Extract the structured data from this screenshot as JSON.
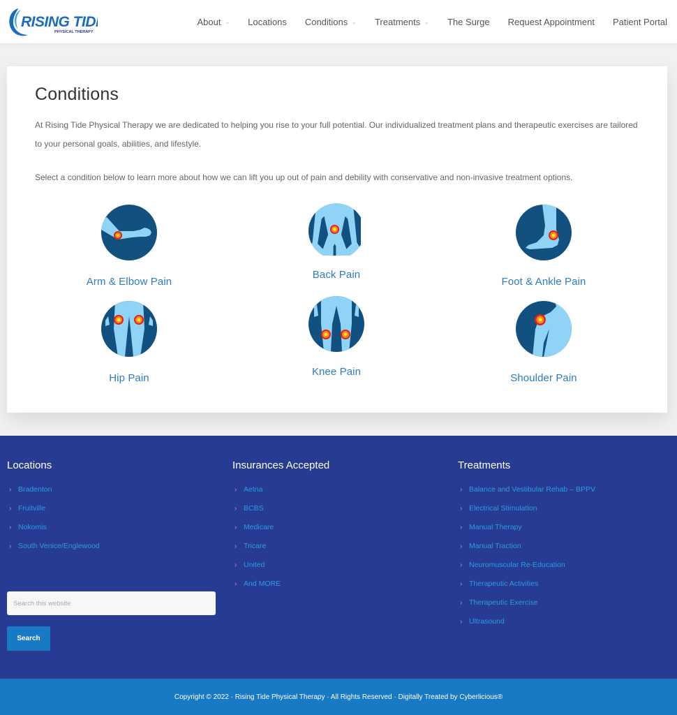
{
  "header": {
    "logo": {
      "title": "RISING TIDE",
      "subtitle": "PHYSICAL THERAPY"
    },
    "nav": [
      {
        "label": "About",
        "has_dropdown": true
      },
      {
        "label": "Locations",
        "has_dropdown": false
      },
      {
        "label": "Conditions",
        "has_dropdown": true
      },
      {
        "label": "Treatments",
        "has_dropdown": true
      },
      {
        "label": "The Surge",
        "has_dropdown": false
      },
      {
        "label": "Request Appointment",
        "has_dropdown": false
      },
      {
        "label": "Patient Portal",
        "has_dropdown": false
      }
    ],
    "caret_glyph": "⌄"
  },
  "main": {
    "title": "Conditions",
    "intro": "At Rising Tide Physical Therapy we are dedicated to helping you rise to your full potential. Our individualized treatment plans and therapeutic exercises are tailored to your personal goals, abilities, and lifestyle.",
    "select_text": "Select a condition below to learn more about how we can lift you up out of pain and debility with conservative and non-invasive treatment options.",
    "conditions": [
      {
        "label": "Arm & Elbow Pain",
        "icon": "arm-elbow-icon"
      },
      {
        "label": "Back Pain",
        "icon": "back-icon"
      },
      {
        "label": "Foot & Ankle Pain",
        "icon": "foot-ankle-icon"
      },
      {
        "label": "Hip Pain",
        "icon": "hip-icon"
      },
      {
        "label": "Knee Pain",
        "icon": "knee-icon"
      },
      {
        "label": "Shoulder Pain",
        "icon": "shoulder-icon"
      }
    ]
  },
  "footer": {
    "locations": {
      "title": "Locations",
      "items": [
        "Bradenton",
        "Fruitville",
        "Nokomis",
        "South Venice/Englewood"
      ]
    },
    "insurances": {
      "title": "Insurances Accepted",
      "items": [
        "Aetna",
        "BCBS",
        "Medicare",
        "Tricare",
        "United",
        "And MORE"
      ]
    },
    "treatments": {
      "title": "Treatments",
      "items": [
        "Balance and Vestibular Rehab – BPPV",
        "Electrical Stimulation",
        "Manual Therapy",
        "Manual Traction",
        "Neuromuscular Re-Education",
        "Therapeutic Activities",
        "Therapeutic Exercise",
        "Ultrasound"
      ]
    },
    "chevron_glyph": "›",
    "search": {
      "placeholder": "Search this website",
      "value": "",
      "button_label": "Search"
    },
    "copyright": "Copyright © 2022 · Rising Tide Physical Therapy · All Rights Reserved · Digitally Treated by Cyberlicious®"
  },
  "colors": {
    "brand_blue": "#2d7cc2",
    "footer_bg": "#273b92",
    "bottom_bar": "#1879c4",
    "link": "#2d9ae0",
    "icon_dark": "#12507f",
    "icon_light": "#8fd3f7"
  }
}
